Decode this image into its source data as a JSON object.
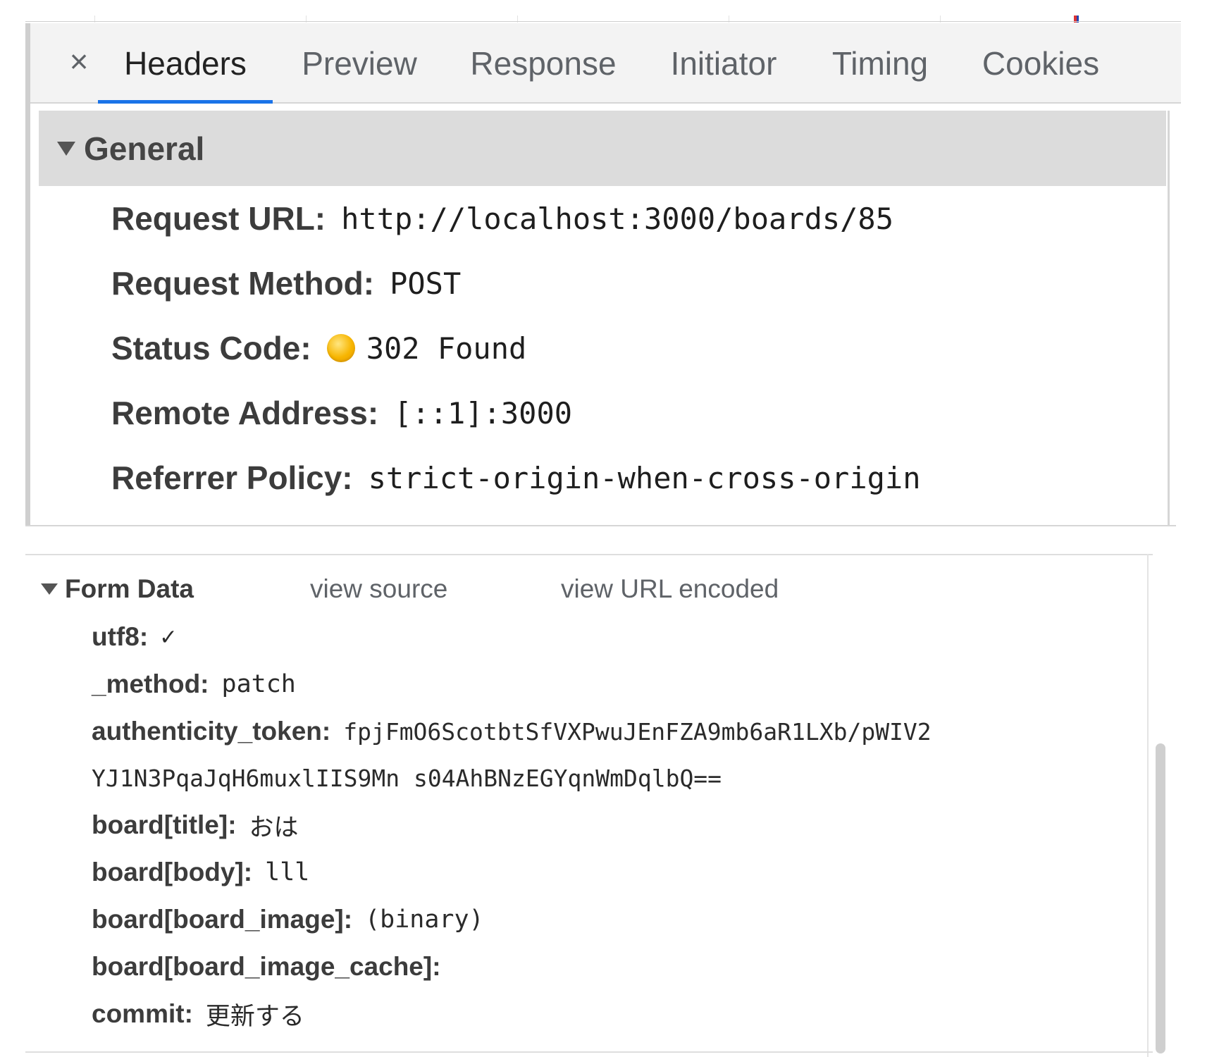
{
  "tabs": {
    "close_symbol": "×",
    "items": [
      "Headers",
      "Preview",
      "Response",
      "Initiator",
      "Timing",
      "Cookies"
    ],
    "active": "Headers",
    "active_color": "#1a73e8"
  },
  "general": {
    "title": "General",
    "rows": [
      {
        "key": "Request URL:",
        "value": "http://localhost:3000/boards/85"
      },
      {
        "key": "Request Method:",
        "value": "POST"
      },
      {
        "key": "Status Code:",
        "value": "302 Found",
        "status_color": "#f7b500"
      },
      {
        "key": "Remote Address:",
        "value": "[::1]:3000"
      },
      {
        "key": "Referrer Policy:",
        "value": "strict-origin-when-cross-origin"
      }
    ]
  },
  "form_data": {
    "title": "Form Data",
    "view_source": "view source",
    "view_url_encoded": "view URL encoded",
    "rows": [
      {
        "key": "utf8:",
        "value": "✓"
      },
      {
        "key": "_method:",
        "value": "patch"
      },
      {
        "key": "authenticity_token:",
        "value": "fpjFmO6ScotbtSfVXPwuJEnFZA9mb6aR1LXb/pWIV2"
      },
      {
        "key": "",
        "value": "YJ1N3PqaJqH6muxlIIS9Mn s04AhBNzEGYqnWmDqlbQ=="
      },
      {
        "key": "board[title]:",
        "value": "おは"
      },
      {
        "key": "board[body]:",
        "value": "lll"
      },
      {
        "key": "board[board_image]:",
        "value": "(binary)"
      },
      {
        "key": "board[board_image_cache]:",
        "value": ""
      },
      {
        "key": "commit:",
        "value": "更新する"
      }
    ]
  }
}
